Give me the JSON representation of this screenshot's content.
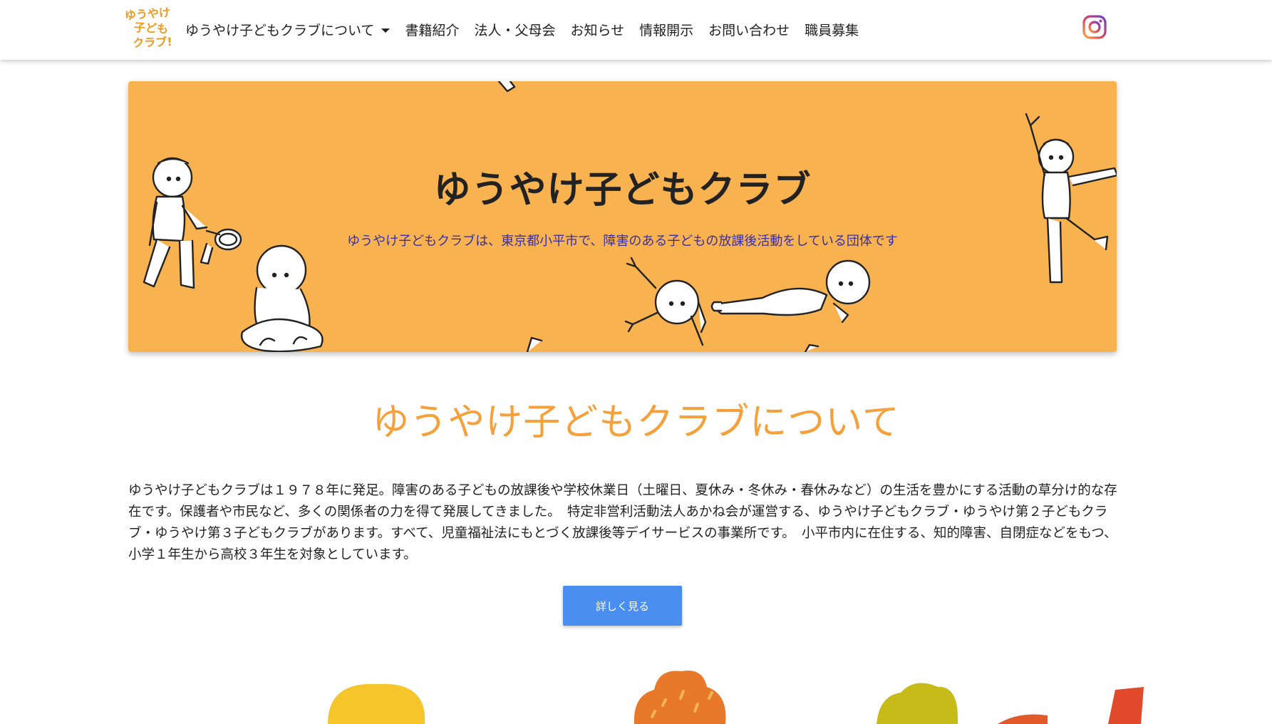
{
  "nav": {
    "logo_lines": [
      "ゆうやけ",
      "子ども",
      "クラブ!"
    ],
    "items": [
      {
        "label": "ゆうやけ子どもクラブについて",
        "has_caret": true
      },
      {
        "label": "書籍紹介"
      },
      {
        "label": "法人・父母会"
      },
      {
        "label": "お知らせ"
      },
      {
        "label": "情報開示"
      },
      {
        "label": "お問い合わせ"
      },
      {
        "label": "職員募集"
      }
    ],
    "social_icon": "instagram-icon"
  },
  "hero": {
    "title": "ゆうやけ子どもクラブ",
    "subtitle": "ゆうやけ子どもクラブは、東京都小平市で、障害のある子どもの放課後活動をしている団体です"
  },
  "about": {
    "title": "ゆうやけ子どもクラブについて",
    "body": "ゆうやけ子どもクラブは１９７８年に発足。障害のある子どもの放課後や学校休業日（土曜日、夏休み・冬休み・春休みなど）の生活を豊かにする活動の草分け的な存在です。保護者や市民など、多くの関係者の力を得て発展してきました。　特定非営利活動法人あかね会が運営する、ゆうやけ子どもクラブ・ゆうやけ第２子どもクラブ・ゆうやけ第３子どもクラブがあります。すべて、児童福祉法にもとづく放課後等デイサービスの事業所です。　小平市内に在住する、知的障害、自閉症などをもつ、小学１年生から高校３年生を対象としています。",
    "button_label": "詳しく見る"
  },
  "colors": {
    "hero_bg": "#f8b350",
    "accent_orange": "#f5a03a",
    "button_blue": "#4a8ef0",
    "subtitle_text": "#3a2fa0"
  }
}
